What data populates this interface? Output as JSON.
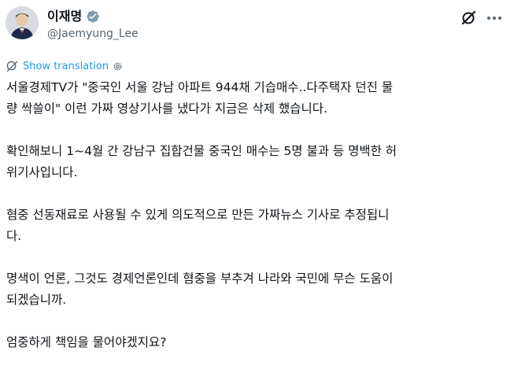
{
  "author": {
    "display_name": "이재명",
    "handle": "@Jaemyung_Lee",
    "verified": true,
    "verified_color": "#829aab"
  },
  "translate": {
    "label": "Show translation",
    "color": "#1d9bf0"
  },
  "header_actions": {
    "grok_icon": "grok-icon",
    "more_icon": "more-horizontal-icon"
  },
  "tweet": {
    "paragraphs": [
      "서울경제TV가 \"중국인 서울 강남 아파트 944채 기습매수..다주택자 던진 물\n량 싹쓸이\" 이런 가짜 영상기사를 냈다가 지금은 삭제 했습니다.",
      "확인해보니 1~4월 간 강남구 집합건물 중국인 매수는 5명 불과 등 명백한 허\n위기사입니다.",
      "혐중 선동재료로 사용될 수 있게 의도적으로 만든 가짜뉴스 기사로 추정됩니\n다.",
      "명색이 언론, 그것도 경제언론인데 혐중을 부추겨 나라와 국민에 무슨 도움이\n되겠습니까.",
      "엄중하게 책임을 물어야겠지요?"
    ]
  }
}
